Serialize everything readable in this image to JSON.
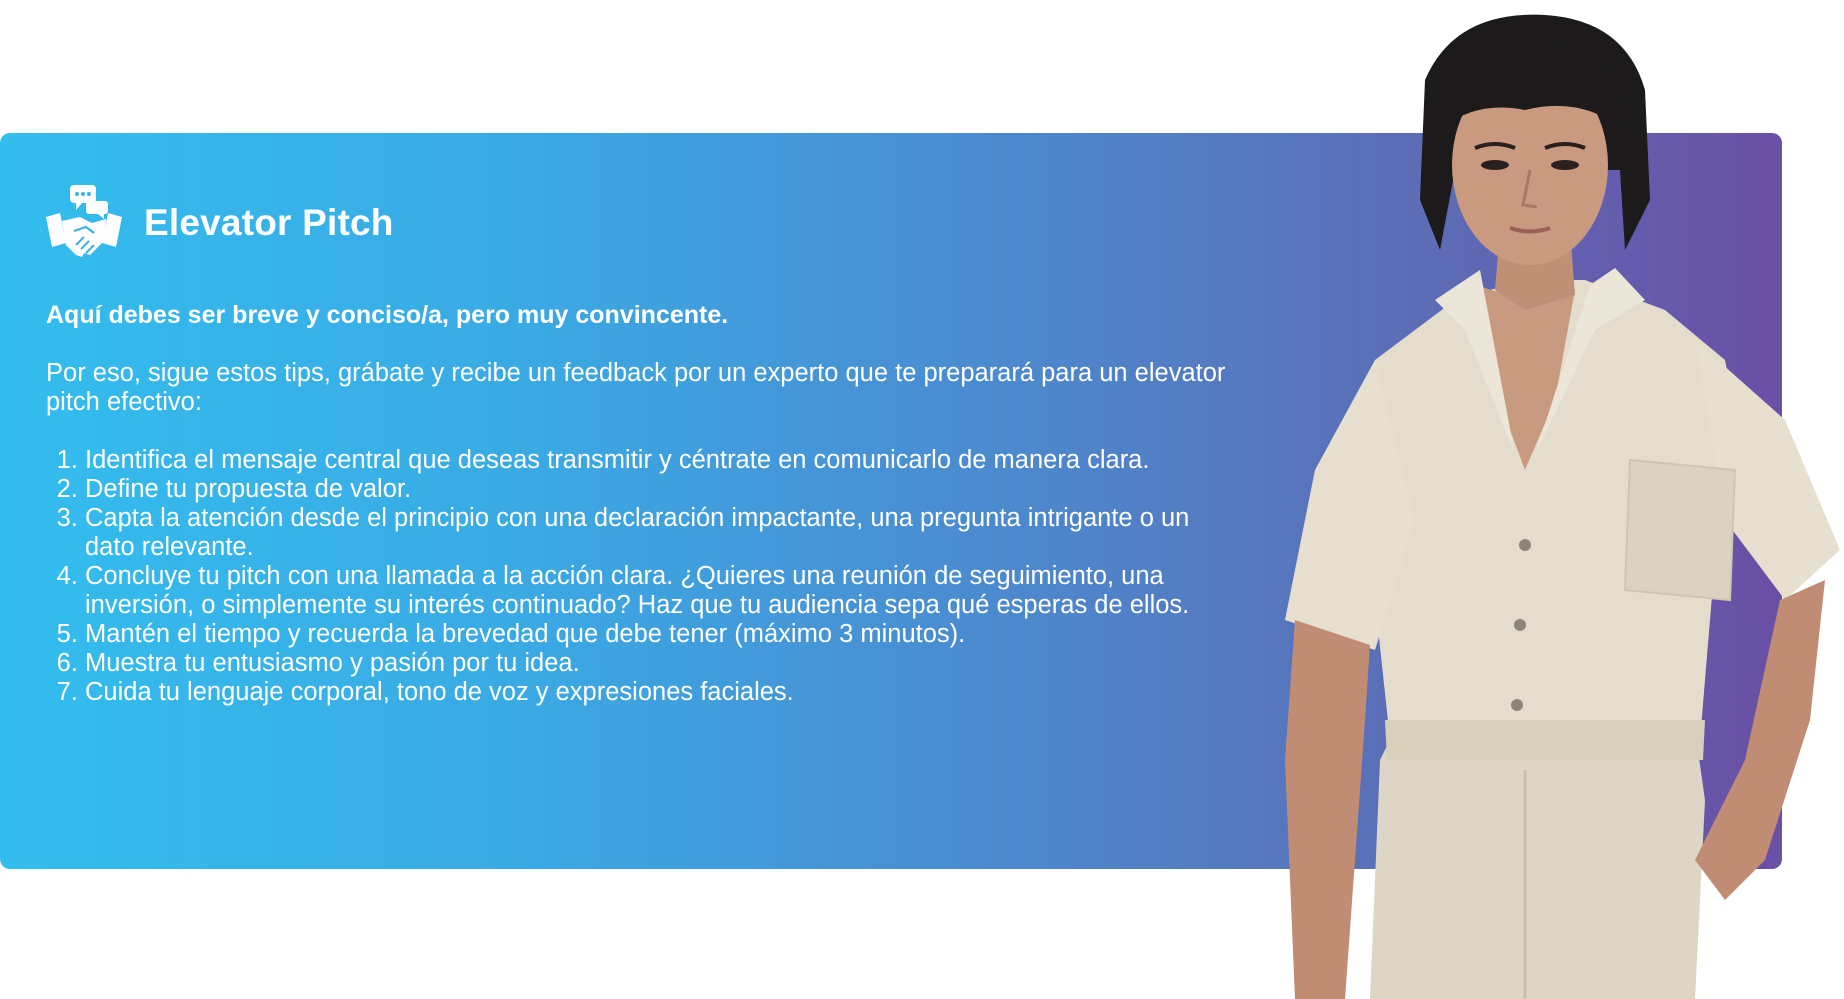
{
  "card": {
    "title": "Elevator Pitch",
    "icon": "handshake-chat-icon",
    "lead": "Aquí debes ser breve y conciso/a, pero muy convincente.",
    "intro": "Por eso, sigue estos tips, grábate y recibe un feedback por un experto que te preparará para un elevator pitch efectivo:",
    "tips": [
      "Identifica el mensaje central que deseas transmitir y céntrate en comunicarlo de manera clara.",
      "Define tu propuesta de valor.",
      "Capta la atención desde el principio con una declaración impactante, una pregunta intrigante o un dato relevante.",
      "Concluye tu pitch con una llamada a la acción clara. ¿Quieres una reunión de seguimiento, una inversión, o simplemente su interés continuado? Haz que tu audiencia sepa qué esperas de ellos.",
      "Mantén el tiempo y recuerda la brevedad que debe tener (máximo 3 minutos).",
      "Muestra tu entusiasmo y pasión por tu idea.",
      "Cuida tu lenguaje corporal, tono de voz y expresiones faciales."
    ]
  },
  "colors": {
    "gradient_start": "#33bdee",
    "gradient_end": "#6a4fa5",
    "text": "#ffffff",
    "outfit": "#e2dccd",
    "hair": "#1c1a1a"
  }
}
